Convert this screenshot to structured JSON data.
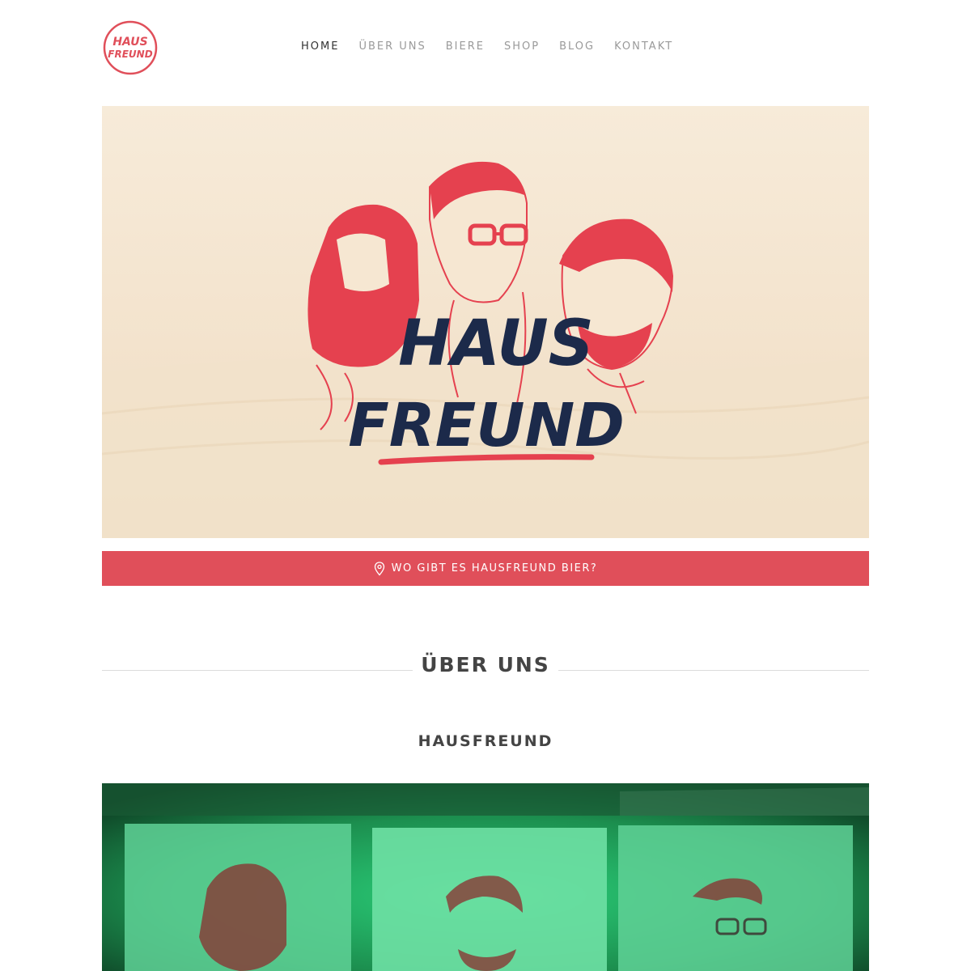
{
  "header": {
    "logo": {
      "line1": "HAUS",
      "line2": "FREUND",
      "color": "#e04f5a"
    },
    "nav": [
      {
        "label": "HOME",
        "active": true
      },
      {
        "label": "ÜBER UNS",
        "active": false
      },
      {
        "label": "BIERE",
        "active": false
      },
      {
        "label": "SHOP",
        "active": false
      },
      {
        "label": "BLOG",
        "active": false
      },
      {
        "label": "KONTAKT",
        "active": false
      }
    ]
  },
  "hero": {
    "wordmark_line1": "HAUS",
    "wordmark_line2": "FREUND",
    "accent_color": "#e5414f",
    "ink_color": "#1c2a4a"
  },
  "find_button": {
    "label": "WO GIBT ES HAUSFREUND BIER?",
    "icon": "map-pin-icon"
  },
  "about": {
    "section_title": "ÜBER UNS",
    "subheading": "HAUSFREUND"
  },
  "photo": {
    "tint_color": "#2bd07a"
  }
}
